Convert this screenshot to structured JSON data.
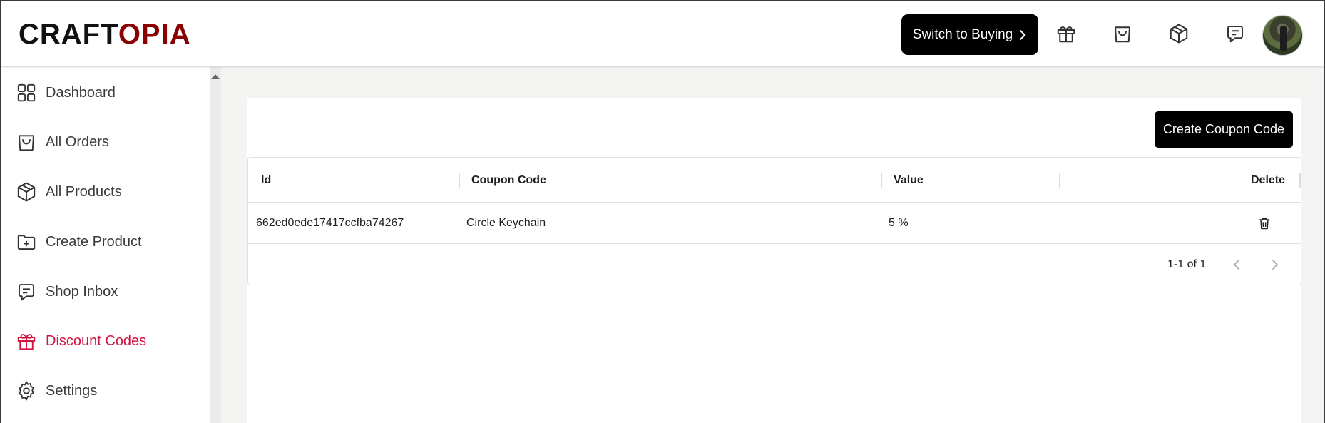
{
  "brand": {
    "part1": "CRAFT",
    "part2": "OPIA"
  },
  "header": {
    "switch_button": "Switch to Buying",
    "icons": [
      "gift-icon",
      "shopping-bag-icon",
      "package-icon",
      "message-icon"
    ]
  },
  "sidebar": {
    "items": [
      {
        "label": "Dashboard",
        "icon": "dashboard-icon",
        "active": false
      },
      {
        "label": "All Orders",
        "icon": "shopping-bag-icon",
        "active": false
      },
      {
        "label": "All Products",
        "icon": "package-icon",
        "active": false
      },
      {
        "label": "Create Product",
        "icon": "folder-plus-icon",
        "active": false
      },
      {
        "label": "Shop Inbox",
        "icon": "message-icon",
        "active": false
      },
      {
        "label": "Discount Codes",
        "icon": "gift-icon",
        "active": true
      },
      {
        "label": "Settings",
        "icon": "gear-icon",
        "active": false
      }
    ]
  },
  "main": {
    "create_button": "Create Coupon Code",
    "table": {
      "columns": [
        "Id",
        "Coupon Code",
        "Value",
        "Delete"
      ],
      "rows": [
        {
          "id": "662ed0ede17417ccfba74267",
          "code": "Circle Keychain",
          "value": "5 %"
        }
      ],
      "pagination": "1-1 of 1"
    }
  },
  "colors": {
    "accent": "#d1123f",
    "logo_dark": "#111111",
    "logo_red": "#8b0000",
    "button": "#000000",
    "main_bg": "#f4f4f2"
  }
}
